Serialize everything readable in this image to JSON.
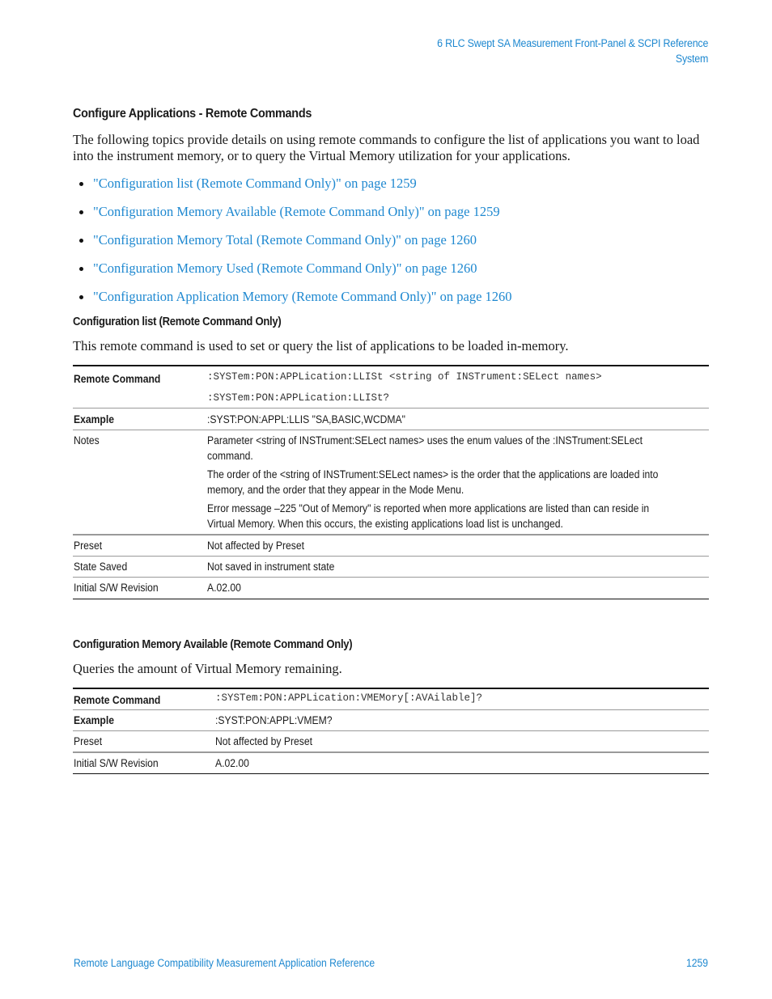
{
  "header": {
    "chapter": "6  RLC Swept SA Measurement Front-Panel & SCPI Reference",
    "section": "System"
  },
  "main": {
    "title": "Configure Applications - Remote Commands",
    "intro": "The following topics provide details on using remote commands to configure the list of applications you want to load into the instrument memory, or to query the Virtual Memory utilization for your applications.",
    "links": [
      {
        "label": "\"Configuration list (Remote Command Only)\" on page 1259"
      },
      {
        "label": "\"Configuration Memory Available (Remote Command Only)\" on page 1259"
      },
      {
        "label": "\"Configuration Memory Total (Remote Command Only)\" on page 1260"
      },
      {
        "label": "\"Configuration Memory Used (Remote Command Only)\" on page 1260"
      },
      {
        "label": "\"Configuration Application Memory (Remote Command Only)\" on page 1260"
      }
    ],
    "sections": [
      {
        "title": "Configuration list (Remote Command Only)",
        "description": "This remote command is used to set or query the list of applications to be loaded in-memory.",
        "table": {
          "remote_command_label": "Remote Command",
          "remote_command": [
            ":SYSTem:PON:APPLication:LLISt <string of INSTrument:SELect names>",
            ":SYSTem:PON:APPLication:LLISt?"
          ],
          "example_label": "Example",
          "example": ":SYST:PON:APPL:LLIS \"SA,BASIC,WCDMA\"",
          "notes_label": "Notes",
          "notes": [
            "Parameter <string of INSTrument:SELect names> uses the enum values of the :INSTrument:SELect command.",
            "The order of the <string of INSTrument:SELect names> is the order that the applications are loaded into memory, and the order that they appear in the Mode Menu.",
            "Error message –225 \"Out of Memory\" is reported when more applications are listed than can reside in Virtual Memory. When this occurs, the existing applications load list is unchanged."
          ],
          "preset_label": "Preset",
          "preset": "Not affected by Preset",
          "state_saved_label": "State Saved",
          "state_saved": "Not saved in instrument state",
          "revision_label": "Initial S/W Revision",
          "revision": "A.02.00"
        }
      },
      {
        "title": "Configuration Memory Available (Remote Command Only)",
        "description": "Queries the amount of Virtual Memory remaining.",
        "table": {
          "remote_command_label": "Remote Command",
          "remote_command": [
            ":SYSTem:PON:APPLication:VMEMory[:AVAilable]?"
          ],
          "example_label": "Example",
          "example": ":SYST:PON:APPL:VMEM?",
          "preset_label": "Preset",
          "preset": "Not affected by Preset",
          "revision_label": "Initial S/W Revision",
          "revision": "A.02.00"
        }
      }
    ]
  },
  "footer": {
    "title": "Remote Language Compatibility Measurement Application Reference",
    "page": "1259"
  },
  "colors": {
    "link": "#1e88d0",
    "text": "#1a1a1a"
  }
}
